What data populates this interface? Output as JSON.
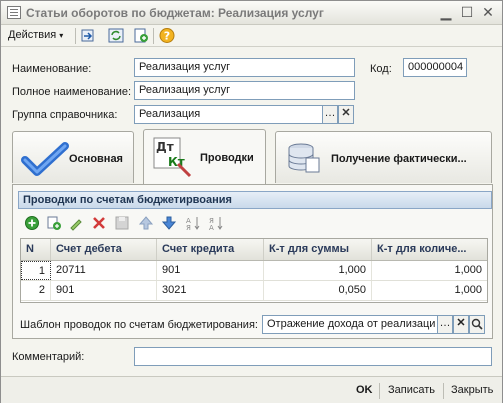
{
  "window": {
    "title": "Статьи оборотов по бюджетам: Реализация услуг"
  },
  "toolbar": {
    "actions_label": "Действия"
  },
  "form": {
    "name_label": "Наименование:",
    "name_value": "Реализация услуг",
    "code_label": "Код:",
    "code_value": "000000004",
    "fullname_label": "Полное наименование:",
    "fullname_value": "Реализация услуг",
    "group_label": "Группа справочника:",
    "group_value": "Реализация"
  },
  "tabs": [
    {
      "label": "Основная",
      "icon": "checkmark-icon"
    },
    {
      "label": "Проводки",
      "icon": "dt-kt-icon"
    },
    {
      "label": "Получение фактически...",
      "icon": "database-icon"
    }
  ],
  "postings": {
    "header": "Проводки по счетам бюджетирвоания",
    "columns": [
      "N",
      "Счет дебета",
      "Счет кредита",
      "К-т для суммы",
      "К-т для количе..."
    ],
    "rows": [
      {
        "n": "1",
        "debit": "20711",
        "credit": "901",
        "k_sum": "1,000",
        "k_qty": "1,000"
      },
      {
        "n": "2",
        "debit": "901",
        "credit": "3021",
        "k_sum": "0,050",
        "k_qty": "1,000"
      }
    ],
    "template_label": "Шаблон проводок по счетам бюджетирования:",
    "template_value": "Отражение дохода от реализаци"
  },
  "comment": {
    "label": "Комментарий:",
    "value": ""
  },
  "footer": {
    "ok": "OK",
    "save": "Записать",
    "close": "Закрыть"
  }
}
